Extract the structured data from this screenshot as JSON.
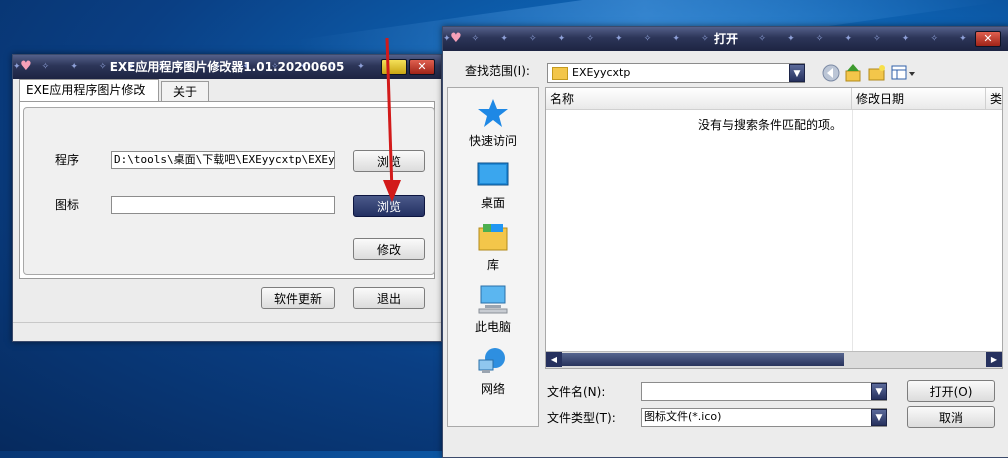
{
  "app_window": {
    "title": "EXE应用程序图片修改器1.01.20200605",
    "tabs": [
      {
        "label": "EXE应用程序图片修改器",
        "selected": true
      },
      {
        "label": "关于",
        "selected": false
      }
    ],
    "program_label": "程序",
    "program_path": "D:\\tools\\桌面\\下载吧\\EXEyycxtp\\EXEyyc",
    "icon_label": "图标",
    "icon_path": "",
    "browse_label_1": "浏览",
    "browse_label_2": "浏览",
    "modify_label": "修改",
    "update_label": "软件更新",
    "exit_label": "退出"
  },
  "open_dialog": {
    "title": "打开",
    "lookin_label": "查找范围(I):",
    "lookin_value": "EXEyycxtp",
    "places": [
      {
        "label": "快速访问",
        "icon": "star-icon"
      },
      {
        "label": "桌面",
        "icon": "desktop-icon"
      },
      {
        "label": "库",
        "icon": "library-icon"
      },
      {
        "label": "此电脑",
        "icon": "computer-icon"
      },
      {
        "label": "网络",
        "icon": "network-icon"
      }
    ],
    "columns": [
      {
        "label": "名称"
      },
      {
        "label": "修改日期"
      },
      {
        "label": "类"
      }
    ],
    "empty_message": "没有与搜索条件匹配的项。",
    "filename_label": "文件名(N):",
    "filename_value": "",
    "filetype_label": "文件类型(T):",
    "filetype_value": "图标文件(*.ico)",
    "open_label": "打开(O)",
    "cancel_label": "取消"
  },
  "colors": {
    "titlebar": "#2c3558",
    "active_button": "#233062",
    "arrow": "#d21a1a",
    "folder": "#f3c64a"
  }
}
